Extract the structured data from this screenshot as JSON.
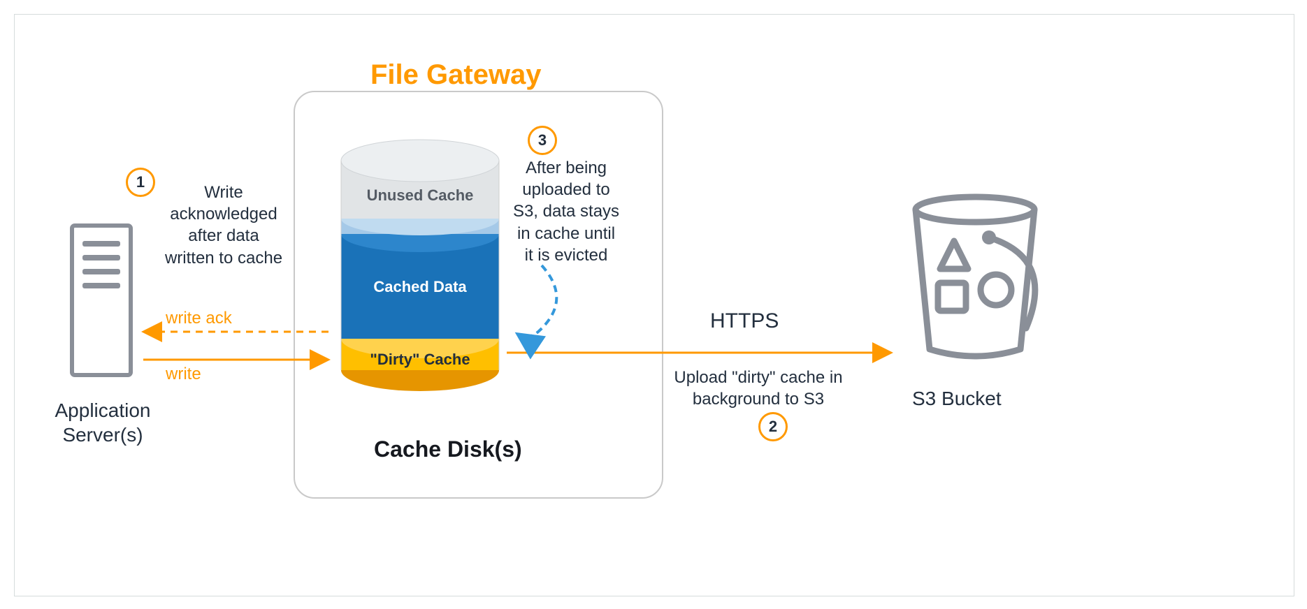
{
  "title": "File Gateway",
  "gateway_box_label": "Cache Disk(s)",
  "app_server": {
    "label": "Application\nServer(s)"
  },
  "s3": {
    "label": "S3 Bucket"
  },
  "cylinder": {
    "unused": "Unused Cache",
    "cached": "Cached Data",
    "dirty": "\"Dirty\" Cache"
  },
  "steps": {
    "one": {
      "num": "1",
      "text": "Write\nacknowledged\nafter data\nwritten to cache"
    },
    "two": {
      "num": "2",
      "text": "Upload \"dirty\" cache in\nbackground to S3",
      "protocol": "HTTPS"
    },
    "three": {
      "num": "3",
      "text": "After being\nuploaded to\nS3, data stays\nin cache until\nit is evicted"
    }
  },
  "arrows": {
    "write": "write",
    "ack": "write ack"
  },
  "colors": {
    "orange": "#ff9900",
    "blue": "#1f77b4",
    "lightblue": "#a5c9e8",
    "darkblue": "#1a72b8",
    "yellow": "#ffbf00",
    "grey": "#dfe3e6",
    "iconGrey": "#8a8f98"
  }
}
